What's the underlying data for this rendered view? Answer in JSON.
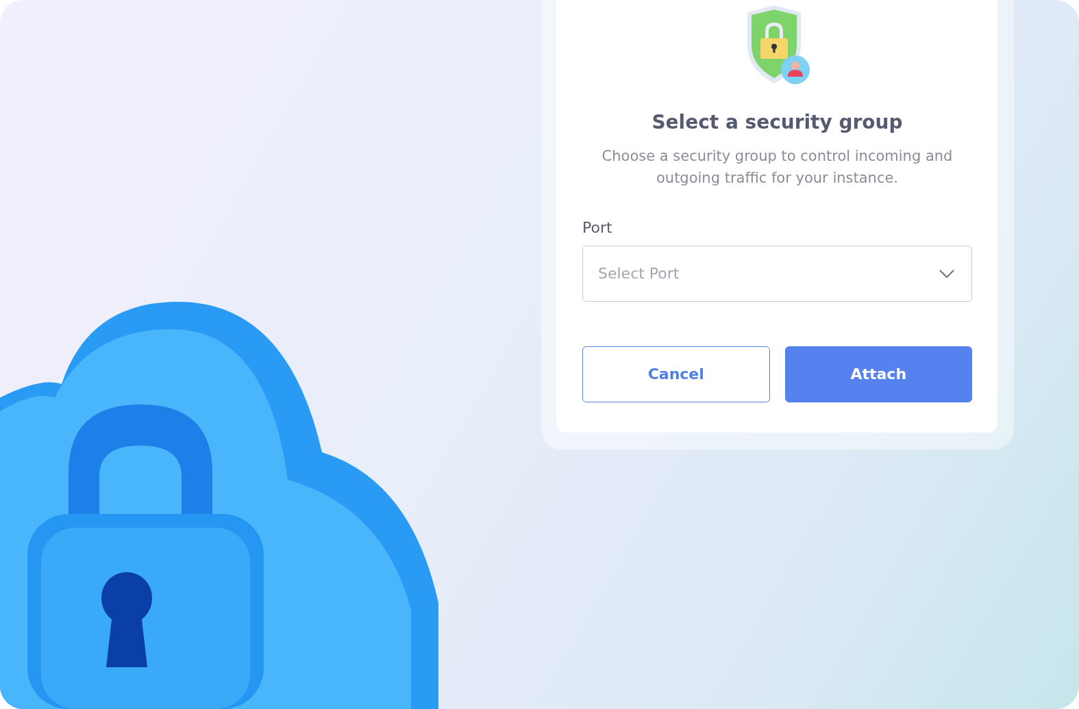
{
  "dialog": {
    "title": "Select a security group",
    "description": "Choose a security group to control incoming and outgoing traffic for your instance.",
    "field": {
      "label": "Port",
      "placeholder": "Select Port"
    },
    "buttons": [
      {
        "label": "Cancel",
        "kind": "secondary"
      },
      {
        "label": "Attach",
        "kind": "primary"
      }
    ]
  }
}
